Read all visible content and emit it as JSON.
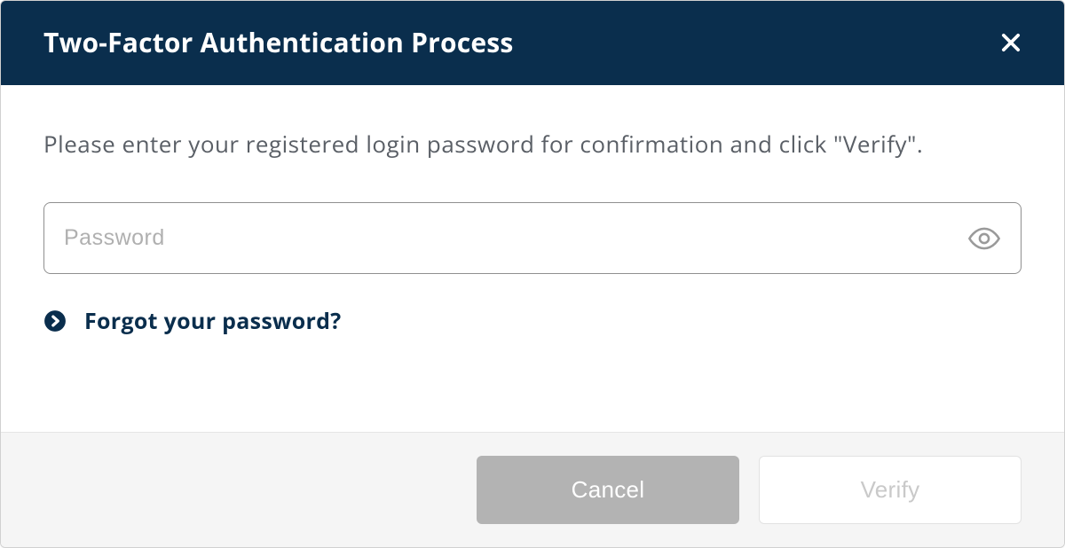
{
  "dialog": {
    "title": "Two-Factor Authentication Process",
    "instruction": "Please enter your registered login password for confirmation and click \"Verify\".",
    "password": {
      "placeholder": "Password",
      "value": ""
    },
    "forgot_link": "Forgot your password?",
    "buttons": {
      "cancel": "Cancel",
      "verify": "Verify"
    }
  }
}
